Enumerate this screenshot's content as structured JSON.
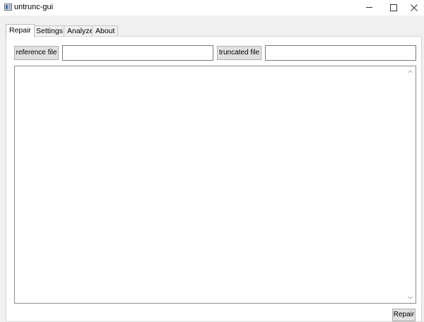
{
  "window": {
    "title": "untrunc-gui"
  },
  "tabs": [
    {
      "label": "Repair",
      "active": true
    },
    {
      "label": "Settings",
      "active": false
    },
    {
      "label": "Analyze",
      "active": false
    },
    {
      "label": "About",
      "active": false
    }
  ],
  "repair": {
    "reference_button": "reference file",
    "reference_value": "",
    "truncated_button": "truncated file",
    "truncated_value": "",
    "log_text": "",
    "repair_button": "Repair"
  },
  "icons": {
    "app": "app-icon",
    "minimize": "minimize-icon",
    "maximize": "maximize-icon",
    "close": "close-icon",
    "scroll_up": "chevron-up-icon",
    "scroll_down": "chevron-down-icon"
  }
}
